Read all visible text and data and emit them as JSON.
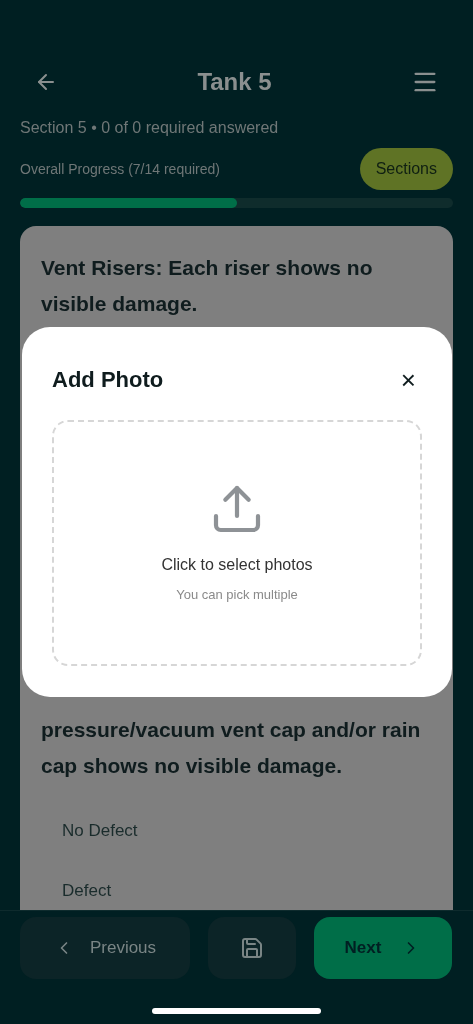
{
  "header": {
    "title": "Tank 5"
  },
  "section_summary": "Section 5 • 0 of 0 required answered",
  "progress": {
    "label": "Overall Progress (7/14 required)",
    "level": 0.5,
    "sections_button": "Sections"
  },
  "questions": [
    {
      "text": "Vent Risers: Each riser shows no visible damage."
    },
    {
      "text": "pressure/vacuum vent cap and/or rain cap shows no visible damage.",
      "options": [
        "No Defect",
        "Defect"
      ]
    }
  ],
  "modal": {
    "title": "Add Photo",
    "close": "×",
    "dropzone_title": "Click to select photos",
    "dropzone_hint": "You can pick multiple"
  },
  "footer": {
    "previous": "Previous",
    "next": "Next"
  }
}
